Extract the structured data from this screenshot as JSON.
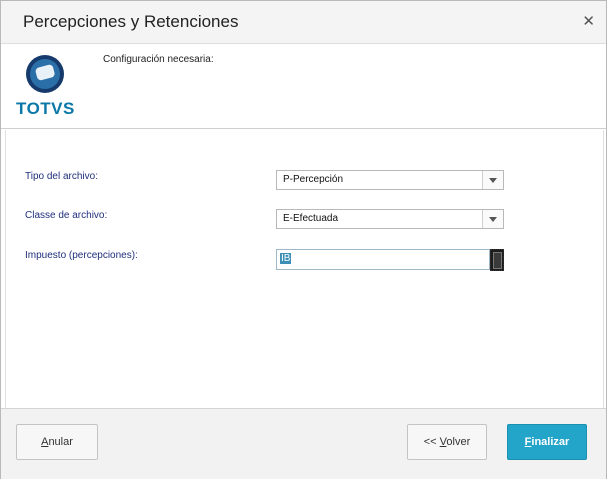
{
  "dialog": {
    "title": "Percepciones y Retenciones"
  },
  "header": {
    "logo_text": "TOTVS",
    "note": "Configuración necesaria:"
  },
  "form": {
    "file_type": {
      "label": "Tipo del archivo:",
      "value": "P-Percepción"
    },
    "file_class": {
      "label": "Classe de archivo:",
      "value": "E-Efectuada"
    },
    "tax": {
      "label": "Impuesto (percepciones):",
      "value": "IB"
    }
  },
  "buttons": {
    "cancel": {
      "mnemonic": "A",
      "rest": "nular"
    },
    "back": {
      "prefix": "<< ",
      "mnemonic": "V",
      "rest": "olver"
    },
    "finish": {
      "mnemonic": "F",
      "rest": "inalizar"
    }
  },
  "colors": {
    "brand": "#0b78a8",
    "primary_button": "#23a5c9",
    "label_text": "#1f2f7c"
  }
}
